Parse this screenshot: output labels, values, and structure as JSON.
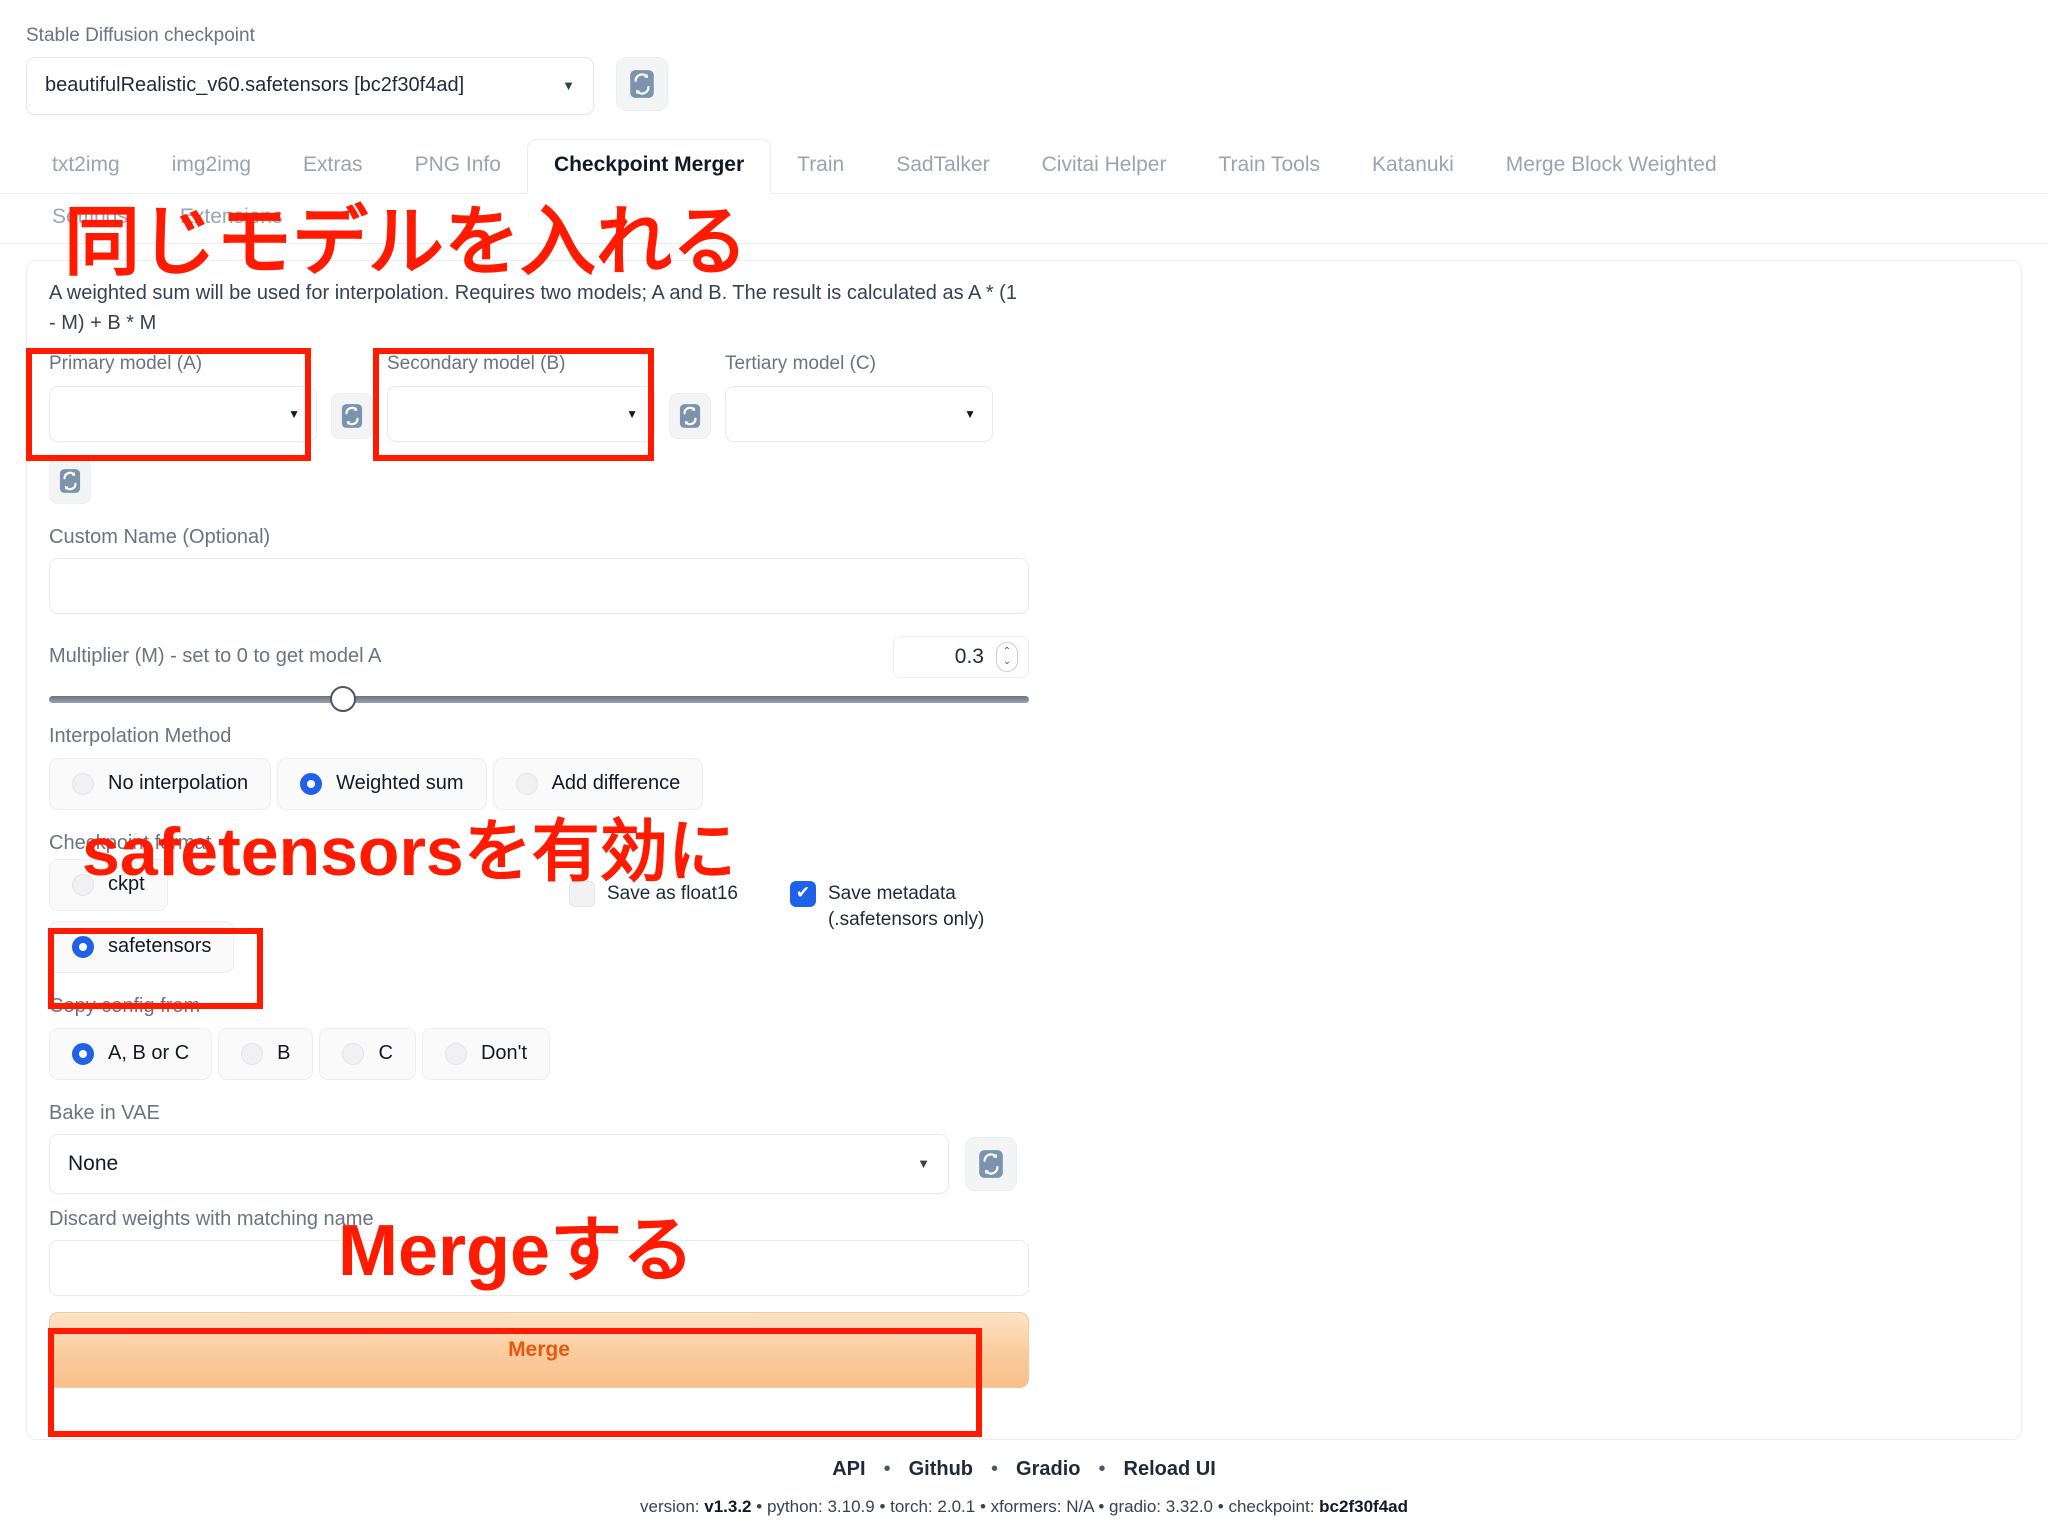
{
  "checkpoint": {
    "label": "Stable Diffusion checkpoint",
    "value": "beautifulRealistic_v60.safetensors [bc2f30f4ad]",
    "caret": "▼",
    "refresh_icon": "refresh-icon"
  },
  "tabs": {
    "row1": [
      {
        "label": "txt2img",
        "active": false
      },
      {
        "label": "img2img",
        "active": false
      },
      {
        "label": "Extras",
        "active": false
      },
      {
        "label": "PNG Info",
        "active": false
      },
      {
        "label": "Checkpoint Merger",
        "active": true
      },
      {
        "label": "Train",
        "active": false
      },
      {
        "label": "SadTalker",
        "active": false
      },
      {
        "label": "Civitai Helper",
        "active": false
      },
      {
        "label": "Train Tools",
        "active": false
      },
      {
        "label": "Katanuki",
        "active": false
      },
      {
        "label": "Merge Block Weighted",
        "active": false
      }
    ],
    "row2": [
      {
        "label": "Settings",
        "active": false
      },
      {
        "label": "Extensions",
        "active": false
      }
    ]
  },
  "merger": {
    "description": "A weighted sum will be used for interpolation. Requires two models; A and B. The result is calculated as A * (1 - M) + B * M",
    "models": [
      {
        "label": "Primary model (A)",
        "value": "",
        "caret": "▼"
      },
      {
        "label": "Secondary model (B)",
        "value": "",
        "caret": "▼"
      },
      {
        "label": "Tertiary model (C)",
        "value": "",
        "caret": "▼"
      }
    ],
    "custom_name": {
      "label": "Custom Name (Optional)",
      "value": "",
      "placeholder": ""
    },
    "multiplier": {
      "label": "Multiplier (M) - set to 0 to get model A",
      "value": "0.3",
      "slider_percent": 30,
      "up_arrow": "⌃",
      "down_arrow": "⌄"
    },
    "interpolation": {
      "label": "Interpolation Method",
      "options": [
        {
          "label": "No interpolation",
          "selected": false
        },
        {
          "label": "Weighted sum",
          "selected": true
        },
        {
          "label": "Add difference",
          "selected": false
        }
      ]
    },
    "format": {
      "label": "Checkpoint format",
      "options": [
        {
          "label": "ckpt",
          "selected": false
        },
        {
          "label": "safetensors",
          "selected": true
        }
      ]
    },
    "save_float16": {
      "label": "Save as float16",
      "checked": false
    },
    "save_metadata": {
      "label_line1": "Save metadata",
      "label_line2": "(.safetensors only)",
      "checked": true,
      "check_glyph": "✔"
    },
    "copy_config": {
      "label": "Copy config from",
      "options": [
        {
          "label": "A, B or C",
          "selected": true
        },
        {
          "label": "B",
          "selected": false
        },
        {
          "label": "C",
          "selected": false
        },
        {
          "label": "Don't",
          "selected": false
        }
      ]
    },
    "bake_vae": {
      "label": "Bake in VAE",
      "value": "None",
      "caret": "▼"
    },
    "discard": {
      "label": "Discard weights with matching name",
      "value": ""
    },
    "merge_button": "Merge"
  },
  "footer": {
    "links": [
      "API",
      "Github",
      "Gradio",
      "Reload UI"
    ],
    "separator": "•",
    "meta": {
      "version_label": "version:",
      "version_value": "v1.3.2",
      "python_label": "python:",
      "python_value": "3.10.9",
      "torch_label": "torch:",
      "torch_value": "2.0.1",
      "xformers_label": "xformers:",
      "xformers_value": "N/A",
      "gradio_label": "gradio:",
      "gradio_value": "3.32.0",
      "checkpoint_label": "checkpoint:",
      "checkpoint_value": "bc2f30f4ad"
    }
  },
  "annotations": {
    "color": "#ff1a00",
    "texts": [
      {
        "text": "同じモデルを入れる"
      },
      {
        "text": "safetensorsを有効に"
      },
      {
        "text": "Mergeする"
      }
    ]
  }
}
